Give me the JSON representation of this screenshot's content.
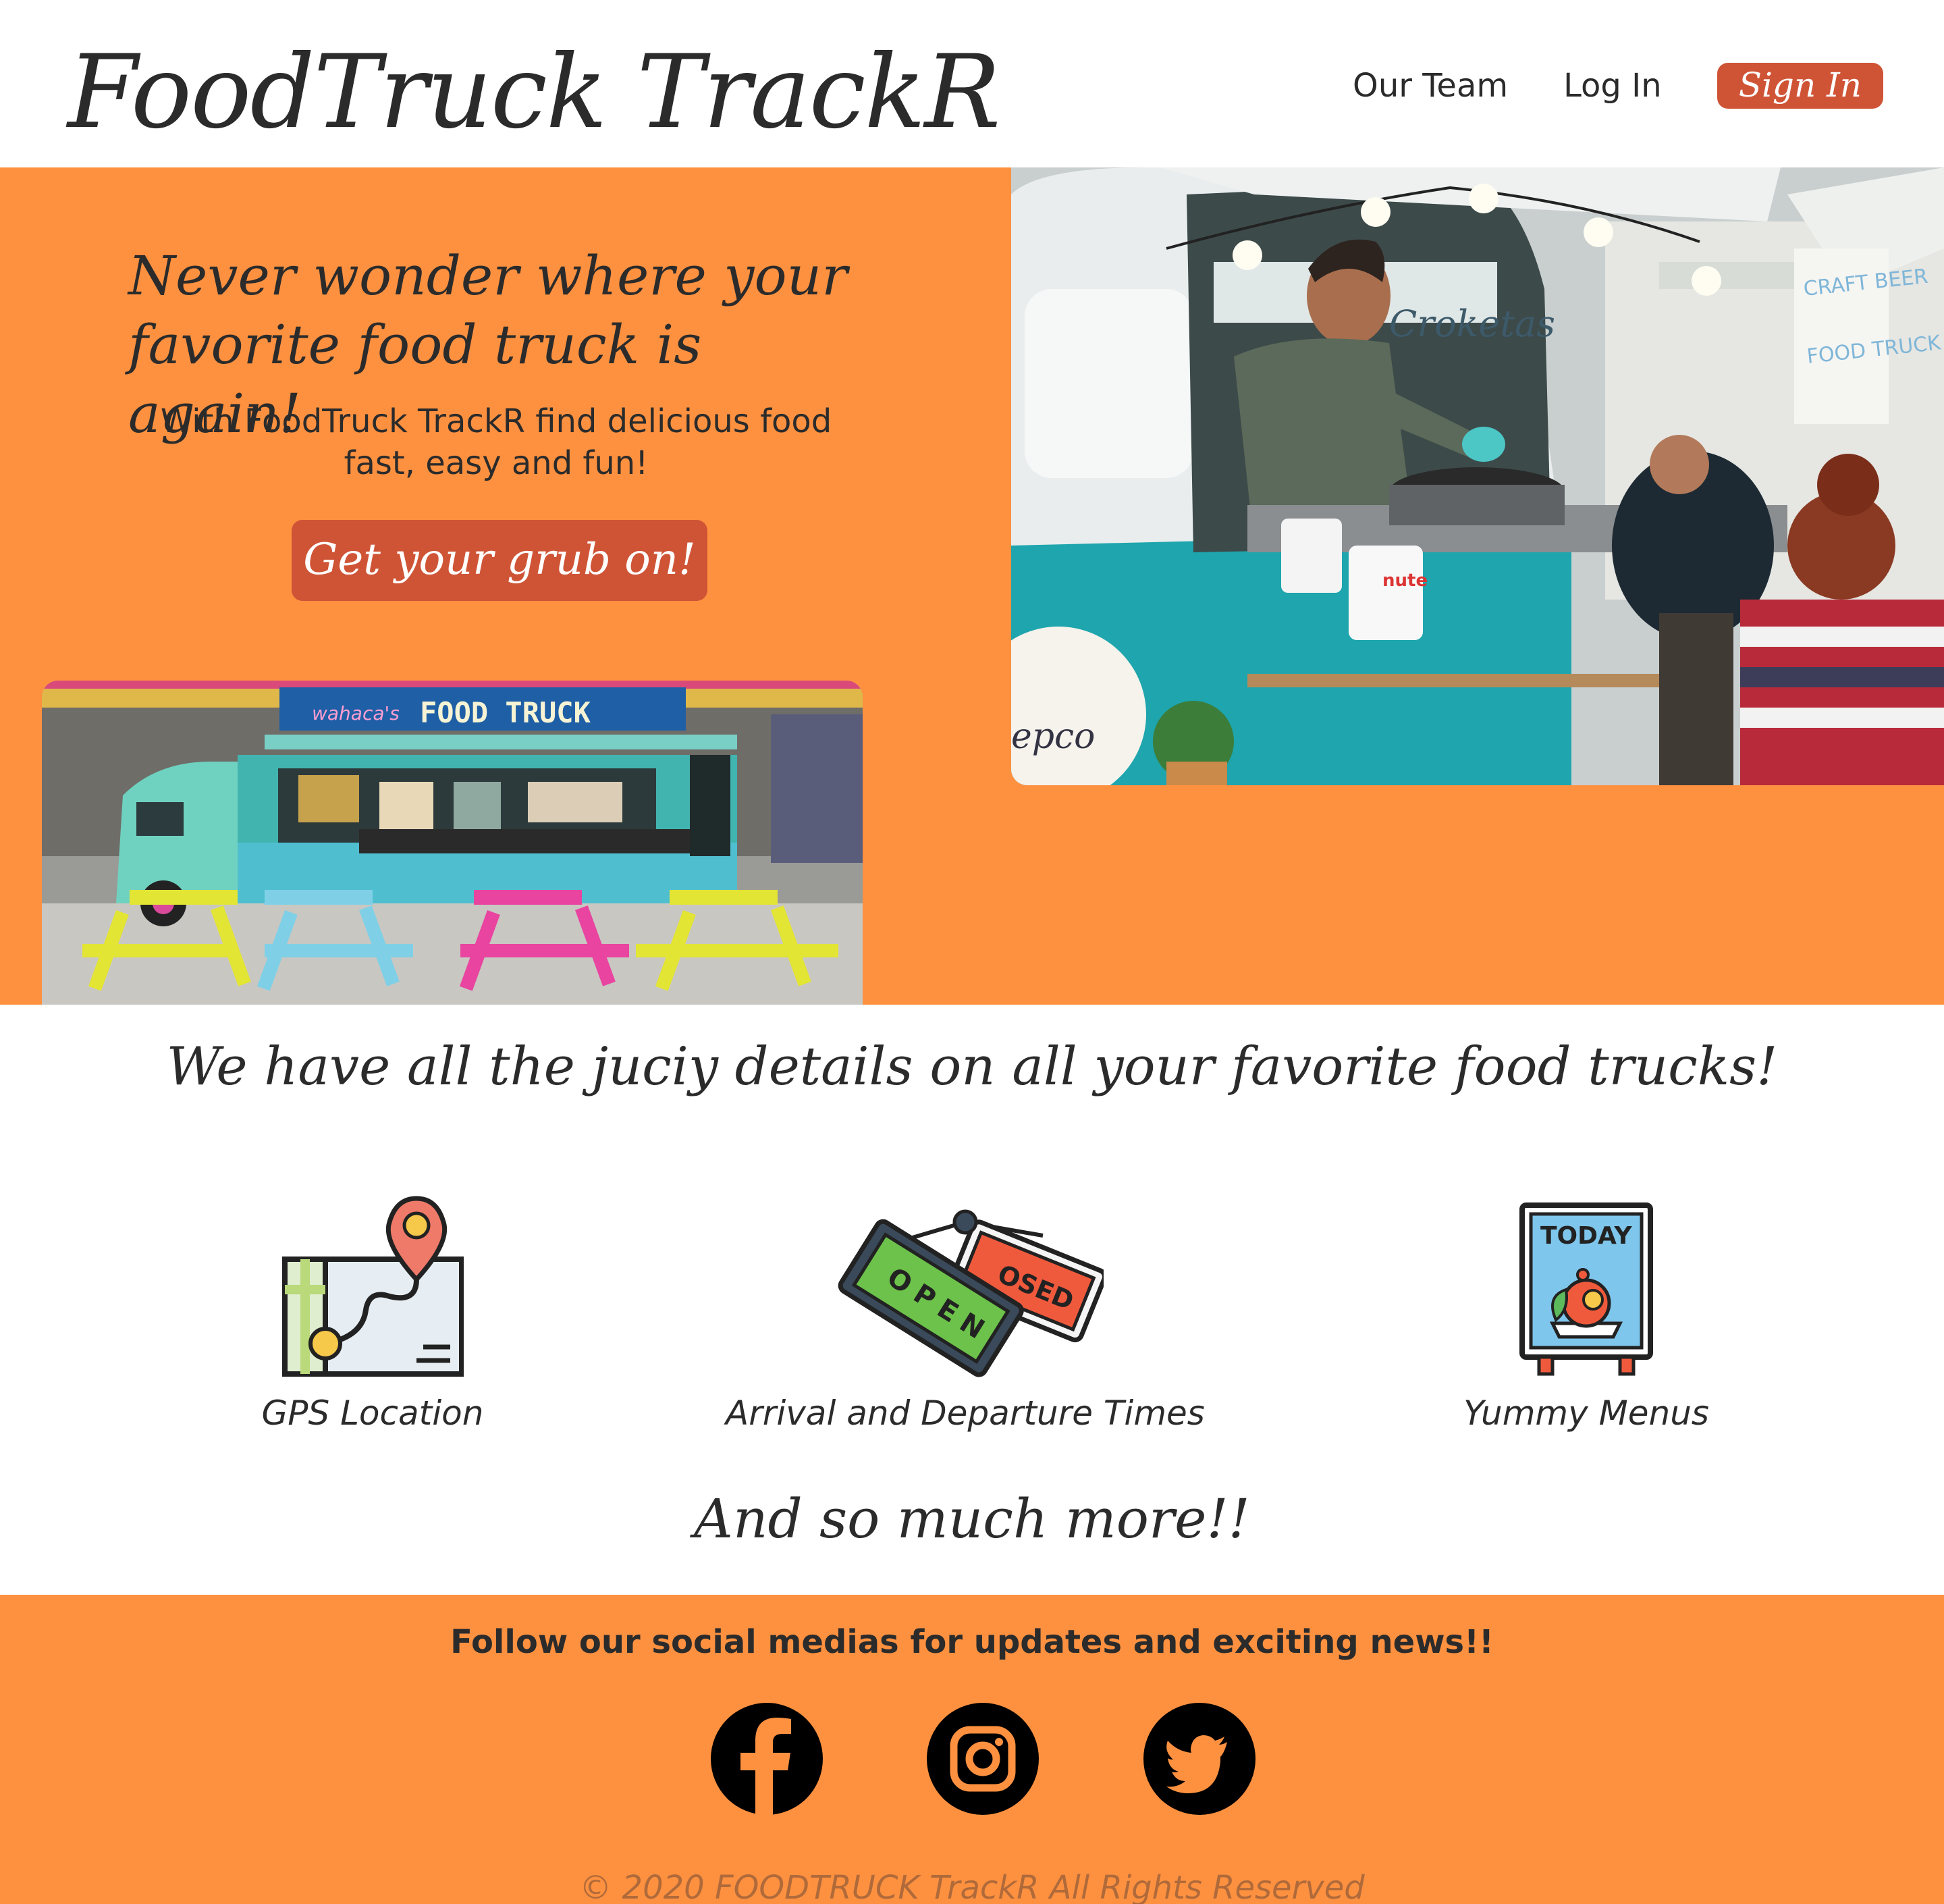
{
  "header": {
    "logo": "FoodTruck TrackR",
    "nav": {
      "our_team": "Our Team",
      "log_in": "Log In",
      "sign_in": "Sign In"
    }
  },
  "hero": {
    "title": "Never wonder where your favorite food truck is again!",
    "subtitle": "With FoodTruck TrackR find delicious food fast, easy and fun!",
    "cta": "Get your grub on!",
    "photo_right": {
      "truck_sign": "Croketas",
      "banner": "CRAFT BEER & FOOD TRUCK",
      "tin": "nute",
      "plate": "epco"
    },
    "photo_left": {
      "brand": "wahaca's",
      "sign": "FOOD TRUCK"
    }
  },
  "details": {
    "title": "We have all the juciy details on all your favorite food trucks!",
    "features": [
      {
        "label": "GPS Location",
        "icon": "gps-map-icon"
      },
      {
        "label": "Arrival and Departure Times",
        "icon": "open-closed-sign-icon",
        "sign_open": "OPEN",
        "sign_closed": "OSED"
      },
      {
        "label": "Yummy Menus",
        "icon": "menu-board-icon",
        "board_text": "TODAY"
      }
    ],
    "more": "And so much more!!"
  },
  "footer": {
    "text": "Follow our social medias for updates and exciting news!!",
    "social": [
      "facebook-icon",
      "instagram-icon",
      "twitter-icon"
    ],
    "copyright": "© 2020 FOODTRUCK TrackR All Rights Reserved"
  },
  "colors": {
    "orange": "#fe9140",
    "accent": "#cf5436",
    "text": "#2b2b2b"
  }
}
